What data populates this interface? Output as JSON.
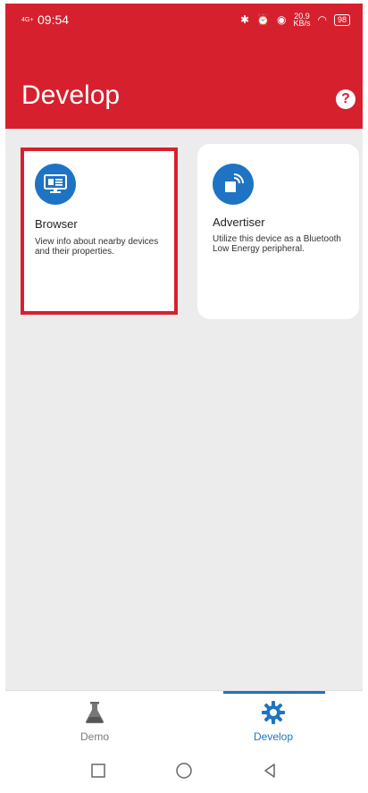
{
  "status_bar": {
    "network": "4G+ ",
    "time": "09:54",
    "speed_value": "20.9",
    "speed_unit": "KB/s",
    "battery": "98"
  },
  "header": {
    "title": "Develop",
    "help_icon": "help-circle-icon"
  },
  "cards": [
    {
      "title": "Browser",
      "description": "View info about nearby devices and their properties.",
      "icon": "browser-monitor-icon"
    },
    {
      "title": "Advertiser",
      "description": "Utilize this device as a Bluetooth Low Energy peripheral.",
      "icon": "advertiser-broadcast-icon"
    }
  ],
  "bottom_nav": {
    "items": [
      {
        "label": "Demo",
        "icon": "flask-icon",
        "active": false
      },
      {
        "label": "Develop",
        "icon": "gear-icon",
        "active": true
      }
    ]
  },
  "colors": {
    "brand_red": "#d6202e",
    "accent_blue": "#1f73c4",
    "content_bg": "#ececec"
  }
}
